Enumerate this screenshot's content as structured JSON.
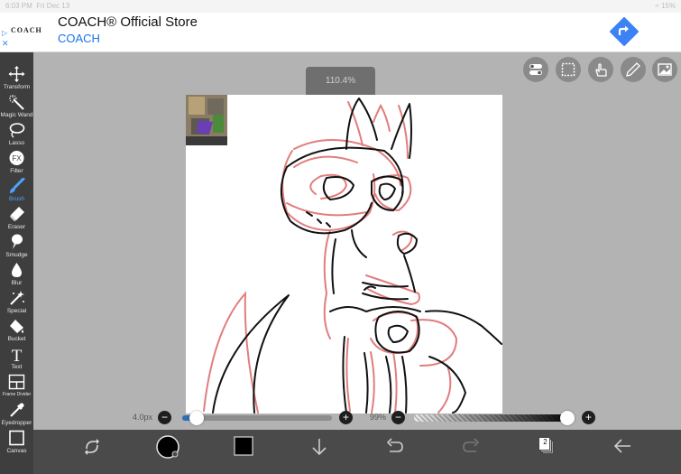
{
  "status_bar": {
    "time": "6:03 PM",
    "date": "Fri Dec 13",
    "battery": "15%"
  },
  "ad": {
    "logo": "COACH",
    "title": "COACH® Official Store",
    "subtitle": "COACH",
    "colors": {
      "link": "#1a73e8",
      "cta": "#3b82f6"
    }
  },
  "toolbar": {
    "tools": [
      {
        "label": "Transform",
        "icon": "move-arrows-icon"
      },
      {
        "label": "Magic Wand",
        "icon": "magic-wand-icon"
      },
      {
        "label": "Lasso",
        "icon": "lasso-icon"
      },
      {
        "label": "Filter",
        "icon": "fx-icon"
      },
      {
        "label": "Brush",
        "icon": "brush-icon",
        "active": true
      },
      {
        "label": "Eraser",
        "icon": "eraser-icon"
      },
      {
        "label": "Smudge",
        "icon": "smudge-icon"
      },
      {
        "label": "Blur",
        "icon": "blur-drop-icon"
      },
      {
        "label": "Special",
        "icon": "special-wand-icon"
      },
      {
        "label": "Bucket",
        "icon": "bucket-icon"
      },
      {
        "label": "Text",
        "icon": "text-icon"
      },
      {
        "label": "Frame Divider",
        "icon": "frame-divider-icon"
      },
      {
        "label": "Eyedropper",
        "icon": "eyedropper-icon"
      },
      {
        "label": "Canvas",
        "icon": "canvas-icon"
      }
    ],
    "active_color": "#4da3ff"
  },
  "top_tools": [
    {
      "icon": "toggle-icon"
    },
    {
      "icon": "selection-icon"
    },
    {
      "icon": "hand-icon"
    },
    {
      "icon": "pen-icon"
    },
    {
      "icon": "image-icon"
    }
  ],
  "zoom": {
    "label": "110.4%"
  },
  "brush": {
    "size_label": "4.0px",
    "level": 0.05
  },
  "opacity": {
    "label": "99%",
    "level": 0.99
  },
  "bottom_bar": {
    "layer_count": "2",
    "primary_color": "#000000",
    "secondary_color": "#000000"
  }
}
